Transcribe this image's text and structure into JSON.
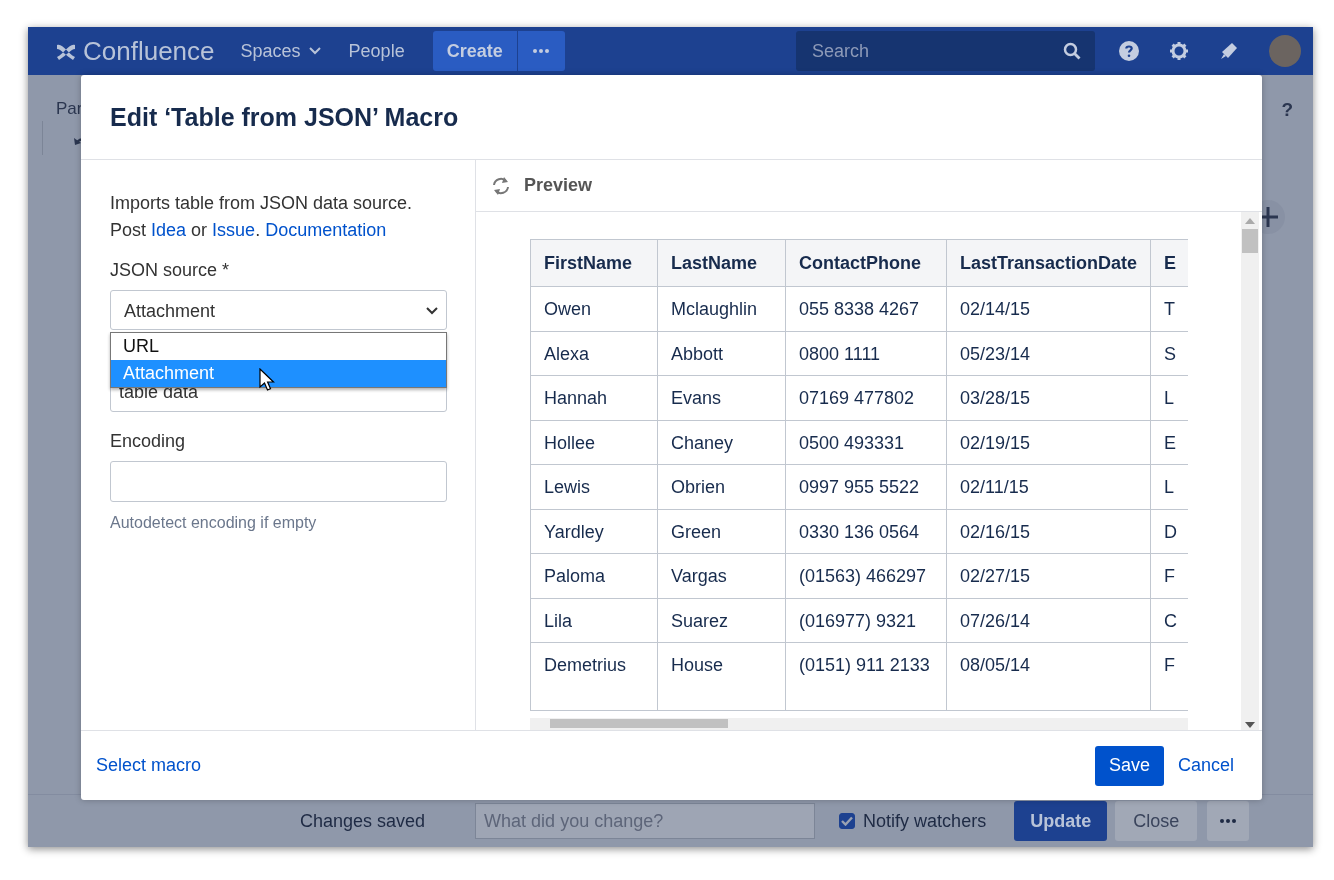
{
  "nav": {
    "logo": "Confluence",
    "links": [
      {
        "label": "Spaces",
        "dropdown": true
      },
      {
        "label": "People",
        "dropdown": false
      }
    ],
    "create": "Create",
    "search": {
      "placeholder": "Search"
    }
  },
  "page": {
    "breadcrumb": "Par",
    "help": "?"
  },
  "dialog": {
    "title": "Edit ‘Table from JSON’ Macro",
    "intro": "Imports table from JSON data source.",
    "links_line": [
      {
        "text": "Post ",
        "kind": "text"
      },
      {
        "text": "Idea",
        "kind": "link"
      },
      {
        "text": " or ",
        "kind": "text"
      },
      {
        "text": "Issue",
        "kind": "link"
      },
      {
        "text": ". ",
        "kind": "text"
      },
      {
        "text": "Documentation",
        "kind": "link"
      }
    ],
    "source": {
      "label": "JSON source *",
      "value": "Attachment",
      "options": [
        {
          "label": "URL",
          "selected": false
        },
        {
          "label": "Attachment",
          "selected": true
        }
      ]
    },
    "data_field": {
      "value": "table data"
    },
    "encoding": {
      "label": "Encoding",
      "hint": "Autodetect encoding if empty"
    },
    "preview": {
      "title": "Preview",
      "columns": [
        "FirstName",
        "LastName",
        "ContactPhone",
        "LastTransactionDate",
        "E"
      ],
      "rows": [
        [
          "Owen",
          "Mclaughlin",
          "055 8338 4267",
          "02/14/15",
          "T"
        ],
        [
          "Alexa",
          "Abbott",
          "0800 1111",
          "05/23/14",
          "S"
        ],
        [
          "Hannah",
          "Evans",
          "07169 477802",
          "03/28/15",
          "L"
        ],
        [
          "Hollee",
          "Chaney",
          "0500 493331",
          "02/19/15",
          "E"
        ],
        [
          "Lewis",
          "Obrien",
          "0997 955 5522",
          "02/11/15",
          "L"
        ],
        [
          "Yardley",
          "Green",
          "0330 136 0564",
          "02/16/15",
          "D"
        ],
        [
          "Paloma",
          "Vargas",
          "(01563) 466297",
          "02/27/15",
          "F"
        ],
        [
          "Lila",
          "Suarez",
          "(016977) 9321",
          "07/26/14",
          "C"
        ],
        [
          "Demetrius",
          "House",
          "(0151) 911 2133",
          "08/05/14",
          "F"
        ]
      ]
    },
    "select_macro": "Select macro",
    "save": "Save",
    "cancel": "Cancel"
  },
  "footer": {
    "status": "Changes saved",
    "comment": {
      "placeholder": "What did you change?"
    },
    "notify": {
      "label": "Notify watchers",
      "checked": true
    },
    "buttons": [
      {
        "label": "Update",
        "kind": "primary"
      },
      {
        "label": "Close",
        "kind": "default"
      }
    ]
  }
}
